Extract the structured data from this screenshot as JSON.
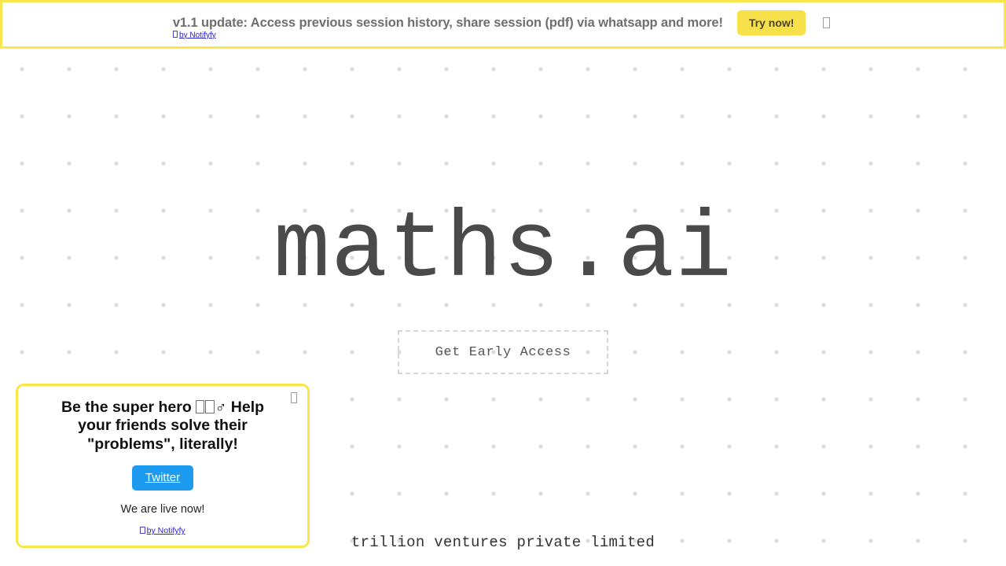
{
  "banner": {
    "message": "v1.1 update: Access previous session history, share session (pdf) via whatsapp and more!",
    "cta_label": "Try now!",
    "credit_label": "by Notifyfy",
    "close_icon": "close-icon",
    "border_color": "#f7e74a",
    "cta_bg_color": "#f7e14a",
    "text_color": "#6f6f6f"
  },
  "hero": {
    "title": "maths.ai",
    "cta_label": "Get Early Access",
    "title_color": "#4a4a4a"
  },
  "footer": {
    "company": "trillion ventures private limited"
  },
  "popup": {
    "heading_part1": "Be the super hero ",
    "heading_gender_sign": "♂",
    "heading_part2": " Help your friends solve their \"problems\", literally!",
    "twitter_label": "Twitter",
    "status": "We are live now!",
    "credit_label": "by Notifyfy",
    "close_icon": "close-icon",
    "border_color": "#f7e74a",
    "twitter_bg_color": "#1d9bf0"
  },
  "background": {
    "dot_color": "#dddddd",
    "dot_spacing_px": 60,
    "page_bg": "#ffffff"
  }
}
